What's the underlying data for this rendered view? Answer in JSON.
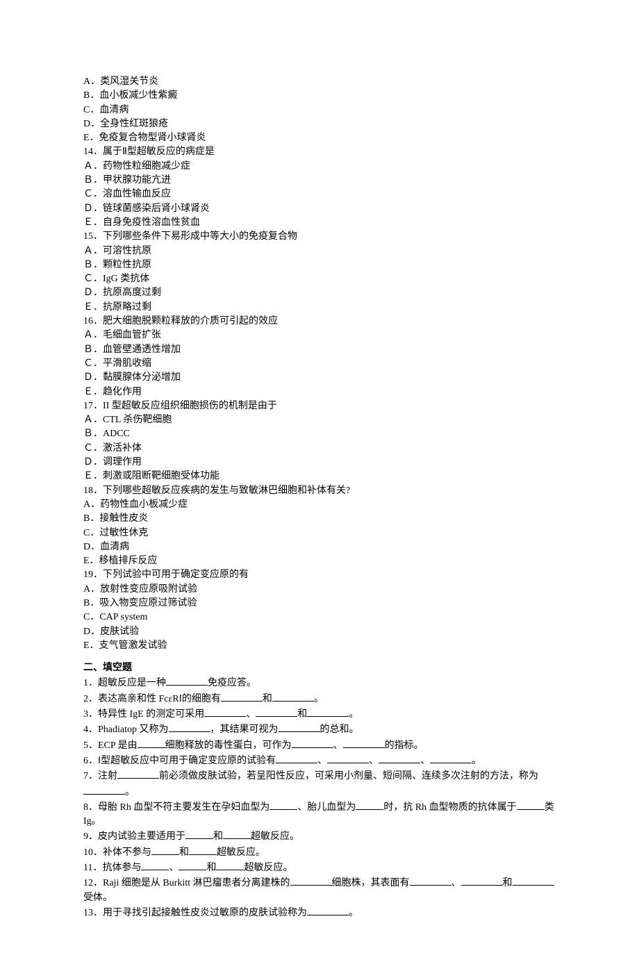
{
  "mc_options_pre": [
    "A．类风湿关节炎",
    "B．血小板减少性紫癜",
    "C．血清病",
    "D．全身性红斑狼疮",
    "E．免疫复合物型肾小球肾炎"
  ],
  "mc_questions": [
    {
      "stem": "14．属于Ⅱ型超敏反应的病症是",
      "options": [
        "Ａ．药物性粒细胞减少症",
        "Ｂ．甲状腺功能亢进",
        "Ｃ．溶血性输血反应",
        "Ｄ．链球菌感染后肾小球肾炎",
        "Ｅ．自身免疫性溶血性贫血"
      ]
    },
    {
      "stem": "15．下列哪些条件下易形成中等大小的免疫复合物",
      "options": [
        "Ａ．可溶性抗原",
        "Ｂ．颗粒性抗原",
        "Ｃ．IgG 类抗体",
        "Ｄ．抗原高度过剩",
        "Ｅ．抗原略过剩"
      ]
    },
    {
      "stem": "16．肥大细胞脱颗粒释放的介质可引起的效应",
      "options": [
        "Ａ．毛细血管扩张",
        "Ｂ．血管壁通透性增加",
        "Ｃ．平滑肌收缩",
        "Ｄ．黏膜腺体分泌增加",
        "Ｅ．趋化作用"
      ]
    },
    {
      "stem": "17．II 型超敏反应组织细胞损伤的机制是由于",
      "options": [
        "Ａ．CTL 杀伤靶细胞",
        "Ｂ．ADCC",
        "Ｃ．激活补体",
        "Ｄ．调理作用",
        "Ｅ．刺激或阻断靶细胞受体功能"
      ]
    },
    {
      "stem": "18．下列哪些超敏反应疾病的发生与致敏淋巴细胞和补体有关?",
      "options": [
        "A．药物性血小板减少症",
        "B．接触性皮炎",
        "C．过敏性休克",
        "D．血清病",
        "E．移植排斥反应"
      ]
    },
    {
      "stem": "19．下列试验中可用于确定变应原的有",
      "options": [
        "A．放射性变应原吸附试验",
        "B．吸入物变应原过筛试验",
        "C．CAP system",
        "D．皮肤试验",
        "E．支气管激发试验"
      ]
    }
  ],
  "section2_heading": "二、填空题",
  "fill": {
    "q1": {
      "pre": "1．超敏反应是一种",
      "post": "免疫应答。"
    },
    "q2": {
      "pre": "2．表达高亲和性 FcεRⅠ的细胞有",
      "mid": "和",
      "post": "。"
    },
    "q3": {
      "pre": "3．特异性 IgE 的测定可采用",
      "sep1": "、",
      "sep2": "和",
      "post": "。"
    },
    "q4": {
      "pre": "4．Phadiatop 又称为",
      "mid": "，其结果可视为",
      "post": "的总和。"
    },
    "q5": {
      "pre": "5．ECP 是由",
      "mid1": "细胞释放的毒性蛋白，可作为",
      "mid2": "、",
      "post": "的指标。"
    },
    "q6": {
      "pre": "6．Ⅰ型超敏反应中可用于确定变应原的试验有",
      "sep": "、",
      "post": "。"
    },
    "q7": {
      "pre": "7．注射",
      "mid": "前必须做皮肤试验，若呈阳性反应，可采用小剂量、短间隔、连续多次注射的方法，称为",
      "post": "。"
    },
    "q8": {
      "pre": "8．母胎 Rh 血型不符主要发生在孕妇血型为",
      "mid1": "、胎儿血型为",
      "mid2": "时，抗 Rh 血型物质的抗体属于",
      "post": "类 Ig。"
    },
    "q9": {
      "pre": "9．皮内试验主要适用于",
      "mid": "和",
      "post": "超敏反应。"
    },
    "q10": {
      "pre": "10．补体不参与",
      "mid": "和",
      "post": "超敏反应。"
    },
    "q11": {
      "pre": "11．抗体参与",
      "sep": "、",
      "mid": "和",
      "post": "超敏反应。"
    },
    "q12": {
      "pre": "12．Raji 细胞是从 Burkitt 淋巴瘤患者分离建株的",
      "mid1": "细胞株，其表面有",
      "mid2": "、",
      "mid3": "和",
      "post": "受体。"
    },
    "q13": {
      "pre": "13．用于寻找引起接触性皮炎过敏原的皮肤试验称为",
      "post": "。"
    }
  }
}
